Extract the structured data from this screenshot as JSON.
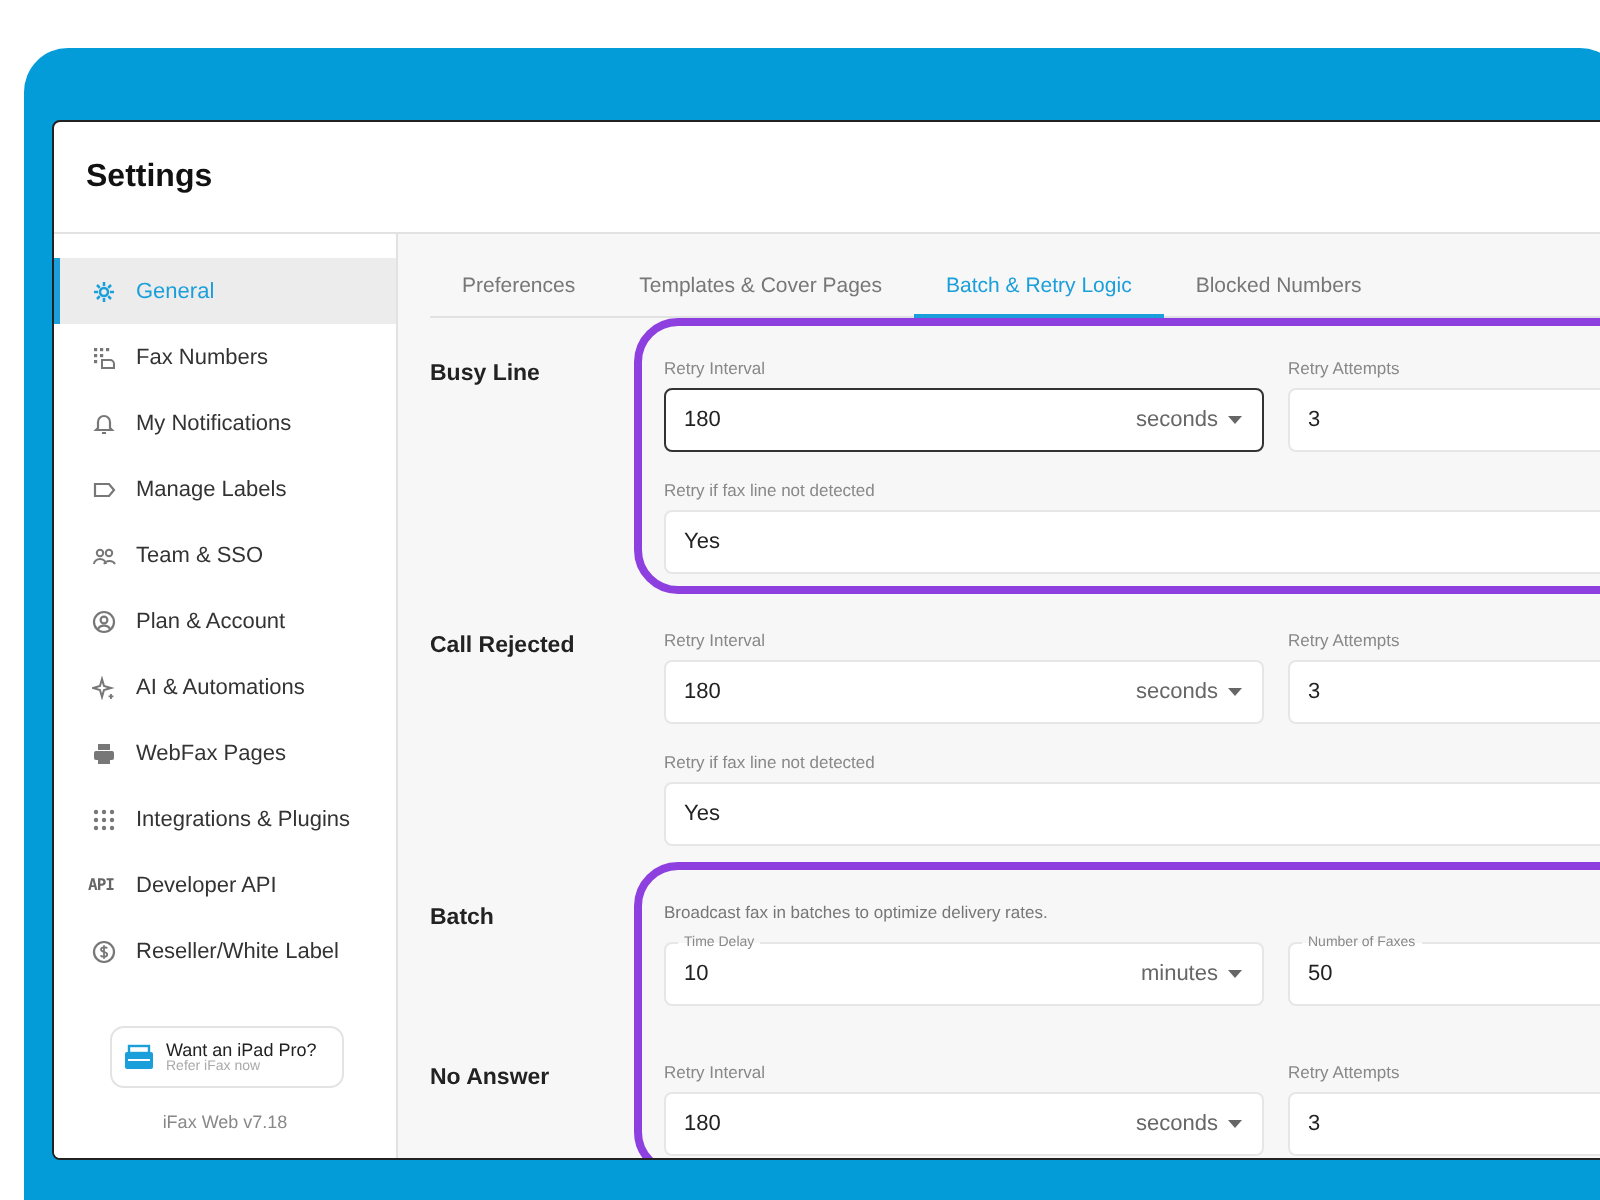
{
  "window": {
    "title": "Settings"
  },
  "sidebar": {
    "items": [
      {
        "label": "General",
        "selected": true
      },
      {
        "label": "Fax Numbers",
        "selected": false
      },
      {
        "label": "My Notifications",
        "selected": false
      },
      {
        "label": "Manage Labels",
        "selected": false
      },
      {
        "label": "Team & SSO",
        "selected": false
      },
      {
        "label": "Plan & Account",
        "selected": false
      },
      {
        "label": "AI & Automations",
        "selected": false
      },
      {
        "label": "WebFax Pages",
        "selected": false
      },
      {
        "label": "Integrations & Plugins",
        "selected": false
      },
      {
        "label": "Developer API",
        "icon_text": "API",
        "selected": false
      },
      {
        "label": "Reseller/White Label",
        "selected": false
      }
    ],
    "promo": {
      "title": "Want an iPad Pro?",
      "subtitle": "Refer iFax now"
    },
    "version": "iFax Web v7.18"
  },
  "tabs": [
    {
      "label": "Preferences",
      "selected": false
    },
    {
      "label": "Templates & Cover Pages",
      "selected": false
    },
    {
      "label": "Batch & Retry Logic",
      "selected": true
    },
    {
      "label": "Blocked Numbers",
      "selected": false
    }
  ],
  "sections": [
    {
      "title": "Busy Line",
      "kind": "retry",
      "highlighted": true,
      "rows": [
        [
          {
            "label": "Retry Interval",
            "value": "180",
            "unit": "seconds",
            "focused": true
          },
          {
            "label": "Retry Attempts",
            "value": "3",
            "focused": false
          }
        ],
        [
          {
            "label": "Retry if fax line not detected",
            "value": "Yes",
            "focused": false
          }
        ]
      ]
    },
    {
      "title": "Call Rejected",
      "kind": "retry",
      "highlighted": false,
      "rows": [
        [
          {
            "label": "Retry Interval",
            "value": "180",
            "unit": "seconds",
            "focused": false
          },
          {
            "label": "Retry Attempts",
            "value": "3",
            "focused": false
          }
        ],
        [
          {
            "label": "Retry if fax line not detected",
            "value": "Yes",
            "focused": false
          }
        ]
      ]
    },
    {
      "title": "Batch",
      "kind": "batch",
      "highlighted": true,
      "description": "Broadcast fax in batches to optimize delivery rates.",
      "rows": [
        [
          {
            "label": "Time Delay",
            "value": "10",
            "unit": "minutes",
            "focused": false
          },
          {
            "label": "Number of Faxes",
            "value": "50",
            "focused": false
          }
        ]
      ]
    },
    {
      "title": "No Answer",
      "kind": "retry",
      "highlighted": true,
      "rows": [
        [
          {
            "label": "Retry Interval",
            "value": "180",
            "unit": "seconds",
            "focused": false
          },
          {
            "label": "Retry Attempts",
            "value": "3",
            "focused": false
          }
        ]
      ]
    }
  ]
}
